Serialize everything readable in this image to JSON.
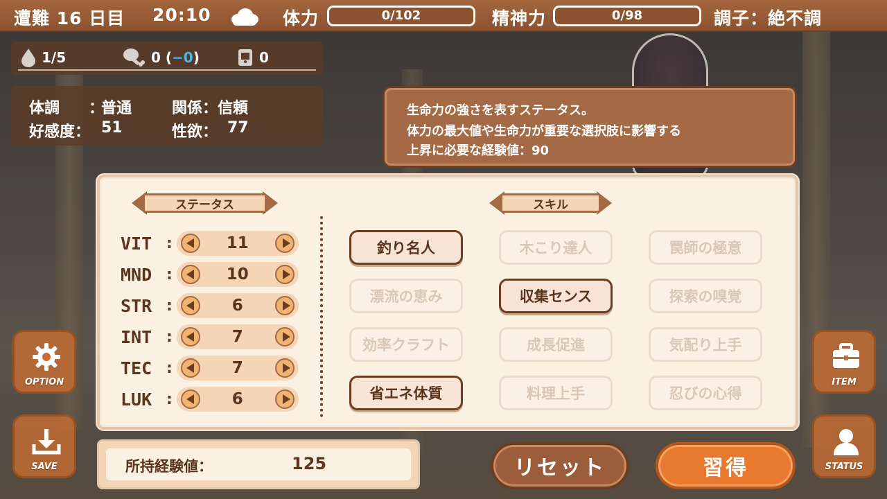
{
  "topbar": {
    "day_label": "遭難 16 日目",
    "time": "20:10",
    "weather_icon": "cloud-icon",
    "stamina_label": "体力",
    "stamina_value": "0/102",
    "stamina_fraction": 0,
    "mind_label": "精神力",
    "mind_value": "0/98",
    "mind_fraction": 0,
    "condition": "調子：絶不調"
  },
  "resources": {
    "water": "1/5",
    "food_prefix": "0 (",
    "food_delta": "−0",
    "food_suffix": ")",
    "items": "0",
    "icons": [
      "water-drop-icon",
      "meat-icon",
      "bottle-icon"
    ]
  },
  "relation": {
    "health_label": "体調",
    "health_sep": "：",
    "health_value": "普通",
    "relation_label": "関係：信頼",
    "affection_label": "好感度：",
    "affection_value": "51",
    "lust_label": "性欲：",
    "lust_value": "77"
  },
  "tooltip": {
    "line1": "生命力の強さを表すステータス。",
    "line2": "体力の最大値や生命力が重要な選択肢に影響する",
    "line3": "上昇に必要な経験値：90"
  },
  "status_header": "ステータス",
  "skill_header": "スキル",
  "stats": [
    {
      "name": "VIT",
      "value": "11"
    },
    {
      "name": "MND",
      "value": "10"
    },
    {
      "name": "STR",
      "value": "6"
    },
    {
      "name": "INT",
      "value": "7"
    },
    {
      "name": "TEC",
      "value": "7"
    },
    {
      "name": "LUK",
      "value": "6"
    }
  ],
  "skills": [
    {
      "label": "釣り名人",
      "active": true
    },
    {
      "label": "木こり達人",
      "active": false
    },
    {
      "label": "罠師の極意",
      "active": false
    },
    {
      "label": "漂流の恵み",
      "active": false
    },
    {
      "label": "収集センス",
      "active": true
    },
    {
      "label": "探索の嗅覚",
      "active": false
    },
    {
      "label": "効率クラフト",
      "active": false
    },
    {
      "label": "成長促進",
      "active": false
    },
    {
      "label": "気配り上手",
      "active": false
    },
    {
      "label": "省エネ体質",
      "active": true
    },
    {
      "label": "料理上手",
      "active": false
    },
    {
      "label": "忍びの心得",
      "active": false
    }
  ],
  "exp": {
    "label": "所持経験値：",
    "value": "125"
  },
  "buttons": {
    "reset": "リセット",
    "learn": "習得"
  },
  "side": {
    "option": "OPTION",
    "save": "SAVE",
    "item": "ITEM",
    "status": "STATUS"
  },
  "colors": {
    "accent": "#e8792e",
    "panel_brown": "#a36a45",
    "dark_brown": "#6b3d22",
    "panel_cream": "#fbf1e2"
  }
}
